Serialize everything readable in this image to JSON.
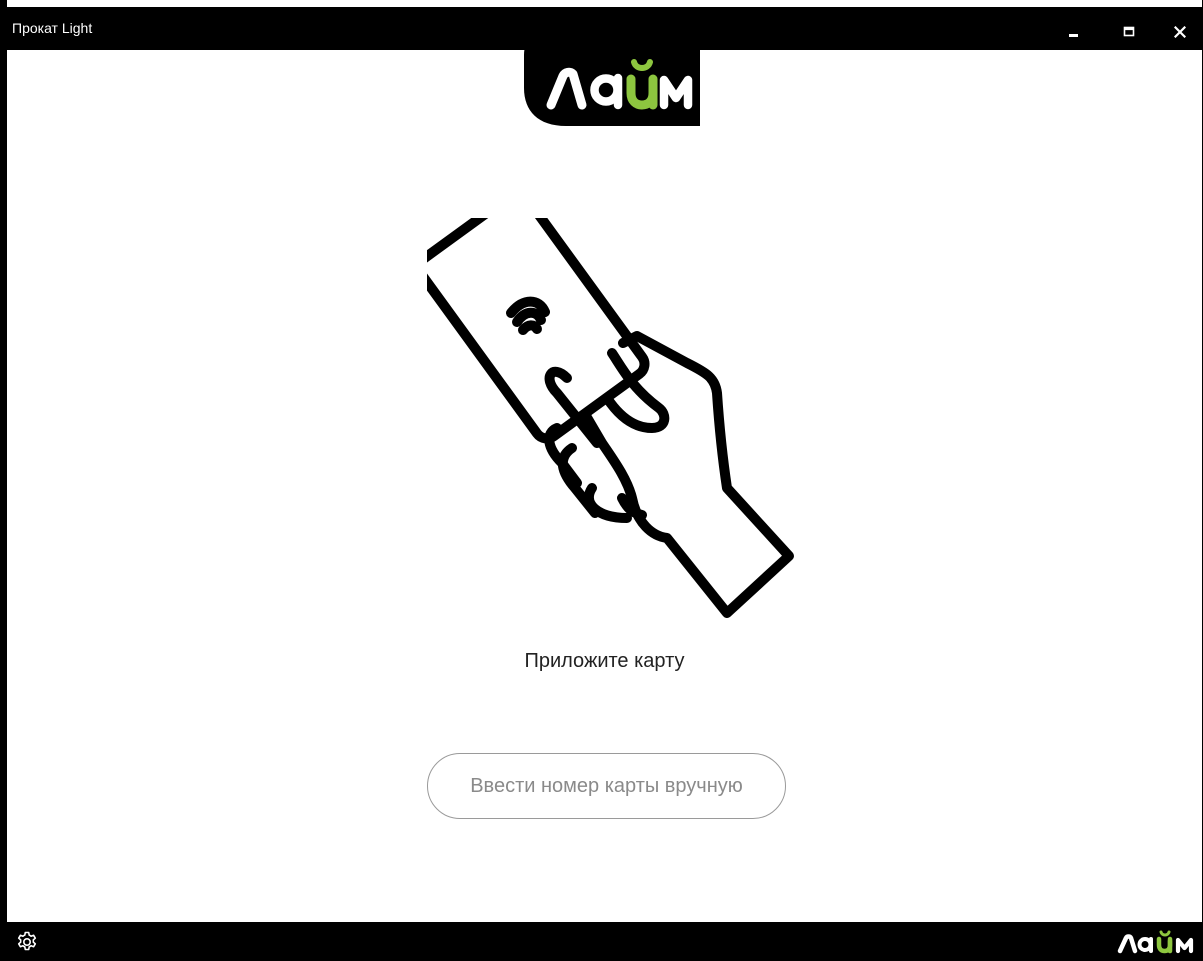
{
  "window": {
    "title": "Прокат Light"
  },
  "logo": {
    "text": "лайм",
    "accent_color": "#8dc63f",
    "background_color": "#000000"
  },
  "main": {
    "prompt": "Приложите карту",
    "manual_entry_button": "Ввести номер карты вручную",
    "illustration_icon": "hand-tap-card-icon"
  },
  "footer": {
    "settings_icon": "gear-icon",
    "logo_text": "лайм"
  }
}
